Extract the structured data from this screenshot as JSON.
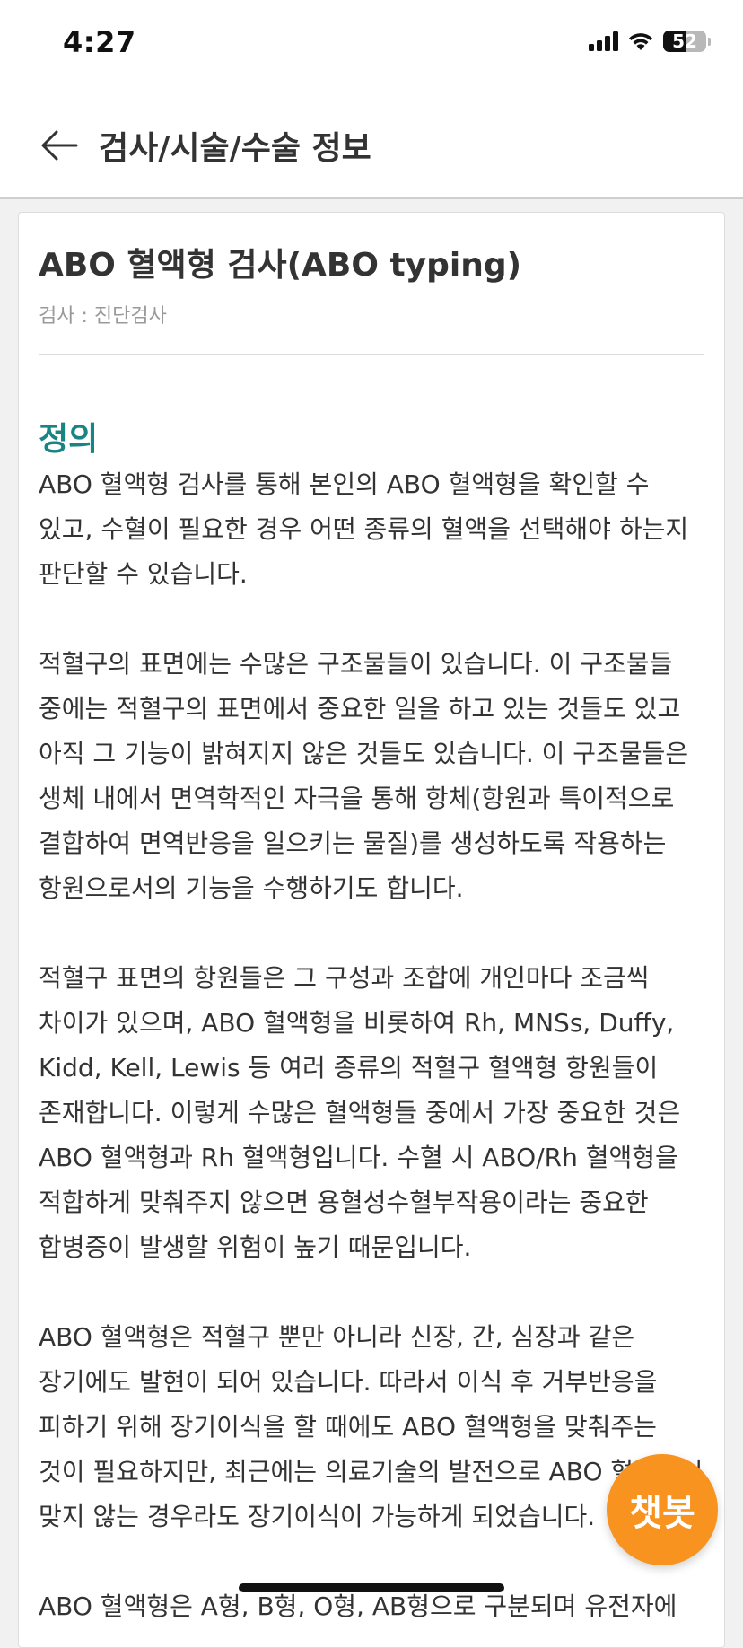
{
  "status_bar": {
    "time": "4:27",
    "battery_percent": 52,
    "battery_label": "52"
  },
  "header": {
    "title": "검사/시술/수술 정보"
  },
  "test": {
    "title": "ABO 혈액형 검사(ABO typing)",
    "category": "검사 : 진단검사"
  },
  "section": {
    "title": "정의",
    "paragraphs": [
      "ABO 혈액형 검사를 통해 본인의 ABO 혈액형을 확인할 수 있고, 수혈이 필요한 경우 어떤 종류의 혈액을 선택해야 하는지 판단할 수 있습니다.",
      "적혈구의 표면에는 수많은 구조물들이 있습니다. 이 구조물들 중에는 적혈구의 표면에서 중요한 일을 하고 있는 것들도 있고 아직 그 기능이 밝혀지지 않은 것들도 있습니다. 이 구조물들은 생체 내에서 면역학적인 자극을 통해 항체(항원과 특이적으로 결합하여 면역반응을 일으키는 물질)를 생성하도록 작용하는 항원으로서의 기능을 수행하기도 합니다.",
      "적혈구 표면의 항원들은 그 구성과 조합에 개인마다 조금씩 차이가 있으며, ABO 혈액형을 비롯하여 Rh, MNSs, Duffy, Kidd, Kell, Lewis 등 여러 종류의 적혈구 혈액형 항원들이 존재합니다. 이렇게 수많은 혈액형들 중에서 가장 중요한 것은 ABO 혈액형과 Rh 혈액형입니다. 수혈 시 ABO/Rh 혈액형을 적합하게 맞춰주지 않으면 용혈성수혈부작용이라는 중요한 합병증이 발생할 위험이 높기 때문입니다.",
      "ABO 혈액형은 적혈구 뿐만 아니라 신장, 간, 심장과 같은 장기에도 발현이 되어 있습니다. 따라서 이식 후 거부반응을 피하기 위해 장기이식을 할 때에도 ABO 혈액형을 맞춰주는 것이 필요하지만, 최근에는 의료기술의 발전으로 ABO 혈액형이 맞지 않는 경우라도 장기이식이 가능하게 되었습니다.",
      "ABO 혈액형은 A형, B형, O형, AB형으로 구분되며 유전자에"
    ]
  },
  "chatbot": {
    "label": "챗봇"
  }
}
